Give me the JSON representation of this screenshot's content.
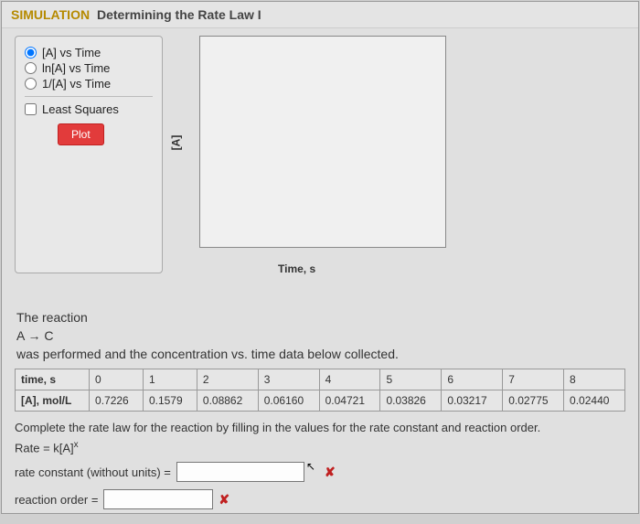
{
  "header": {
    "sim": "SIMULATION",
    "title": "Determining the Rate Law I"
  },
  "options": {
    "opt1": "[A] vs Time",
    "opt2": "ln[A] vs Time",
    "opt3": "1/[A] vs Time",
    "least_squares": "Least Squares",
    "plot_btn": "Plot"
  },
  "chart": {
    "ylabel": "[A]",
    "xlabel": "Time, s"
  },
  "reaction": {
    "line1": "The reaction",
    "line2": "A → C",
    "line3": "was performed and the concentration vs. time data below collected."
  },
  "table": {
    "row1_label": "time, s",
    "row2_label": "[A], mol/L",
    "row1": [
      "0",
      "1",
      "2",
      "3",
      "4",
      "5",
      "6",
      "7",
      "8"
    ],
    "row2": [
      "0.7226",
      "0.1579",
      "0.08862",
      "0.06160",
      "0.04721",
      "0.03826",
      "0.03217",
      "0.02775",
      "0.02440"
    ]
  },
  "instruction": "Complete the rate law for the reaction by filling in the values for the rate constant and reaction order.",
  "rate_eq_prefix": "Rate = k[A]",
  "rate_eq_exp": "x",
  "form": {
    "rate_constant_label": "rate constant (without units) =",
    "reaction_order_label": "reaction order =",
    "x_mark": "✘"
  },
  "chart_data": {
    "type": "line",
    "title": "",
    "xlabel": "Time, s",
    "ylabel": "[A]",
    "x": [],
    "series": [],
    "xlim": null,
    "ylim": null,
    "note": "chart area is blank in screenshot"
  }
}
